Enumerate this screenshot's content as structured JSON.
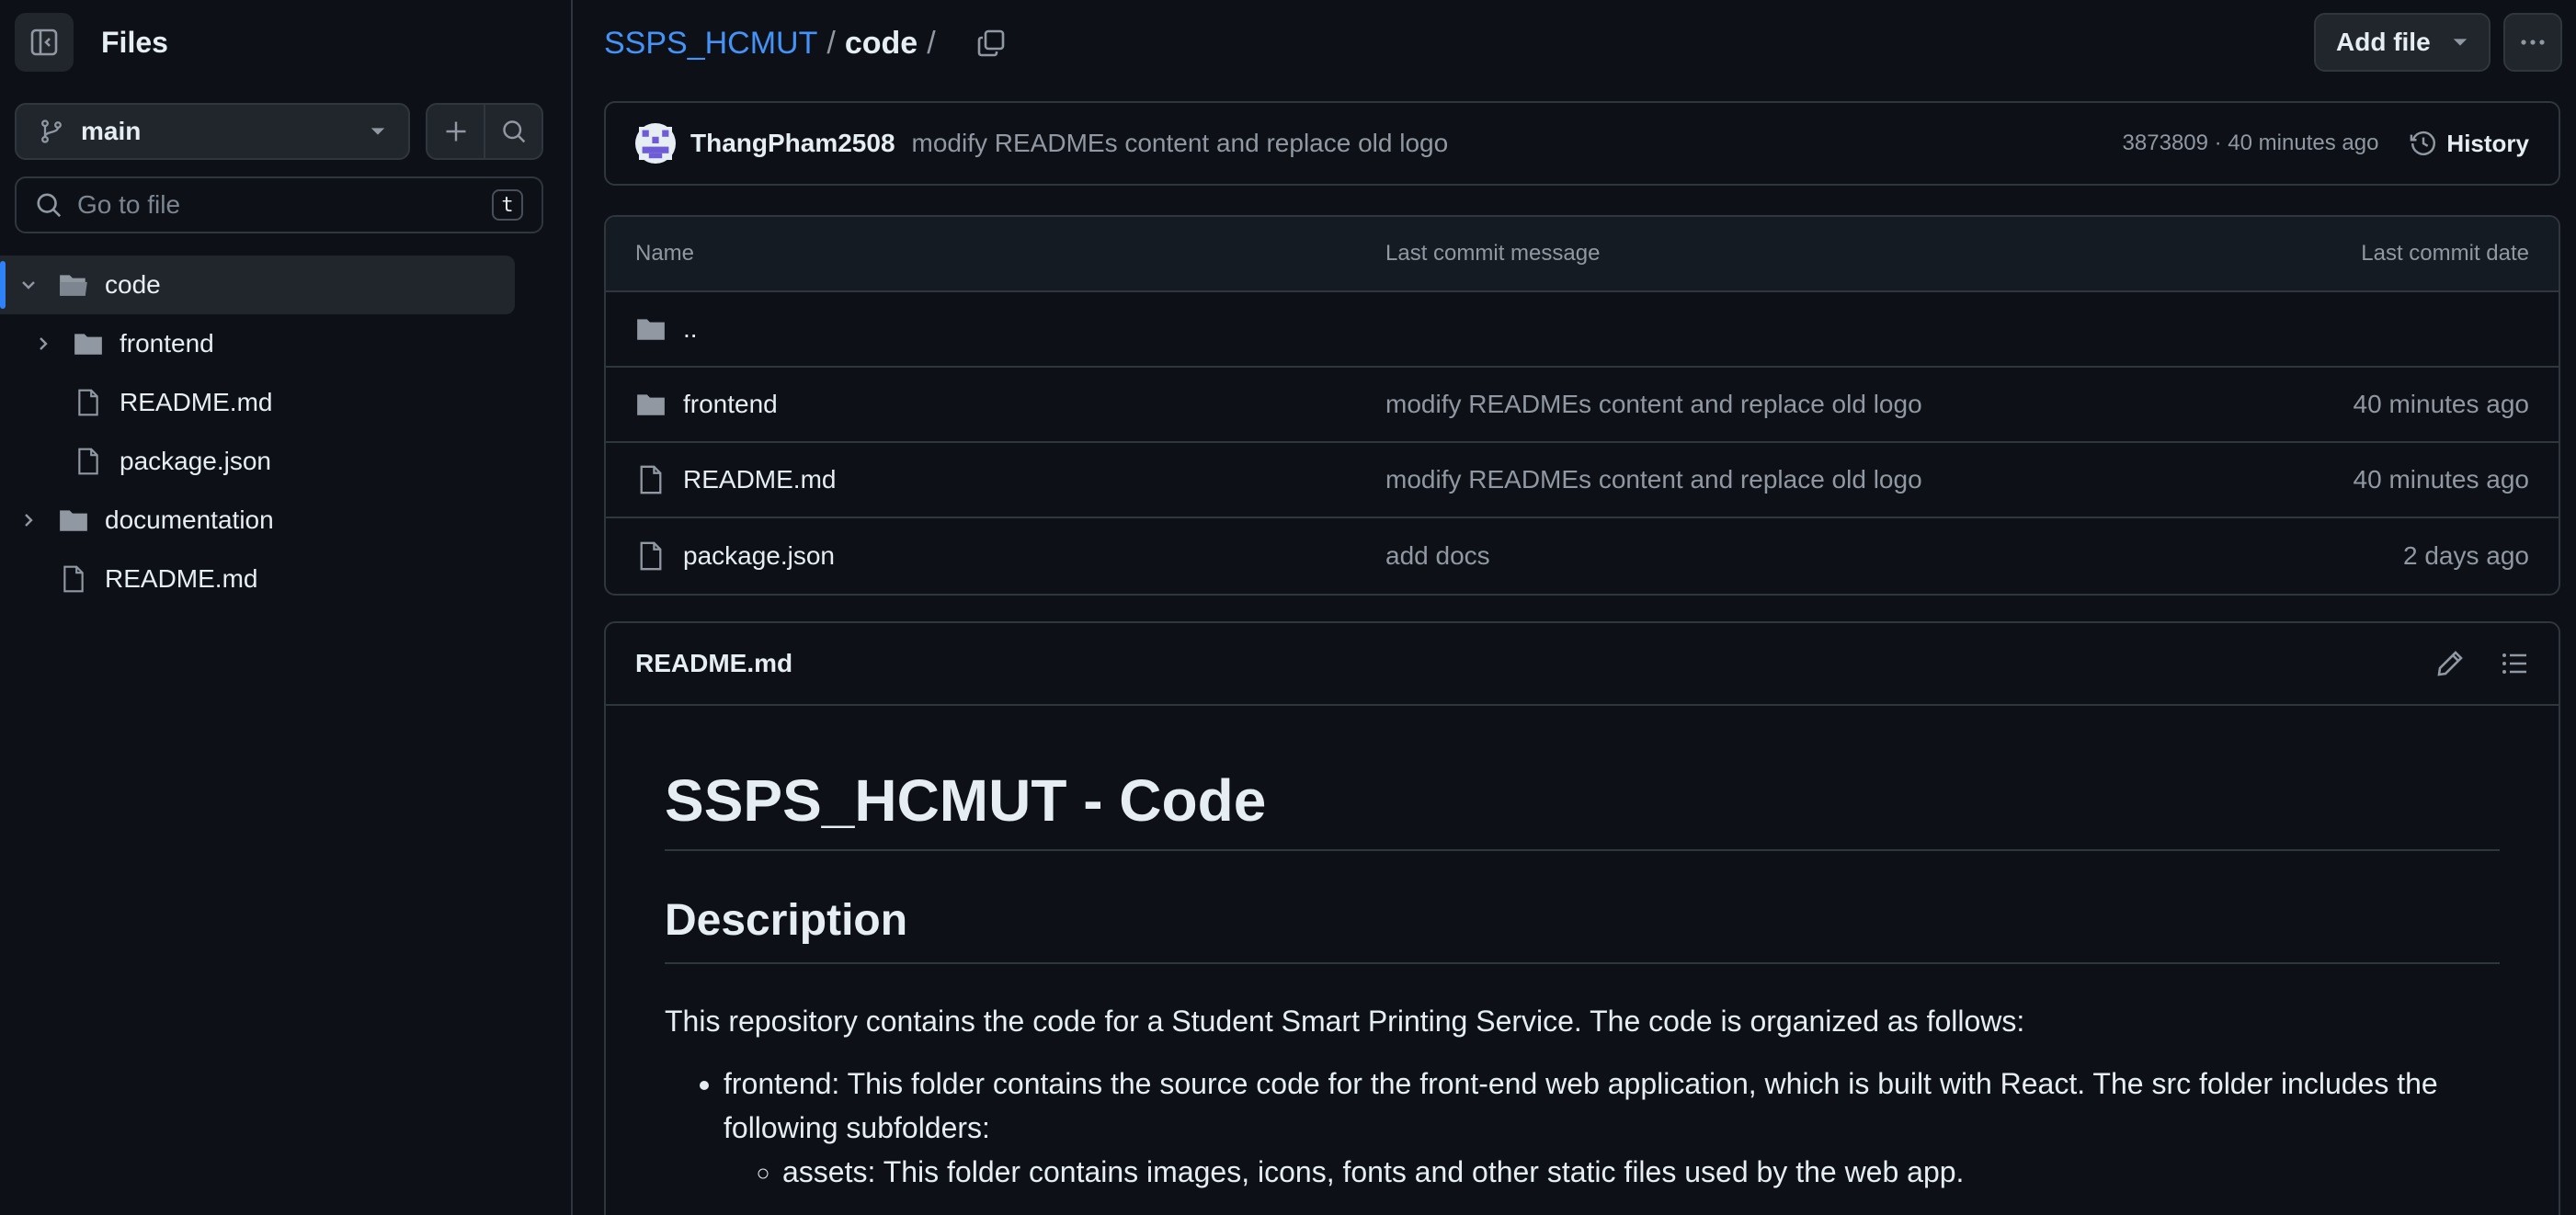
{
  "sidebar": {
    "title": "Files",
    "branch": "main",
    "goto_placeholder": "Go to file",
    "goto_shortcut": "t",
    "tree": [
      {
        "label": "code",
        "type": "folder-open",
        "expanded": true,
        "depth": 0
      },
      {
        "label": "frontend",
        "type": "folder",
        "expanded": false,
        "depth": 1
      },
      {
        "label": "README.md",
        "type": "file",
        "depth": 1
      },
      {
        "label": "package.json",
        "type": "file",
        "depth": 1
      },
      {
        "label": "documentation",
        "type": "folder",
        "expanded": false,
        "depth": 0
      },
      {
        "label": "README.md",
        "type": "file",
        "depth": 0
      }
    ]
  },
  "breadcrumb": {
    "repo": "SSPS_HCMUT",
    "separator": "/",
    "current": "code",
    "trailing": "/"
  },
  "toolbar": {
    "add_file": "Add file"
  },
  "commit": {
    "author": "ThangPham2508",
    "message": "modify READMEs content and replace old logo",
    "meta": "3873809 · 40 minutes ago",
    "history": "History"
  },
  "files": {
    "headers": {
      "name": "Name",
      "message": "Last commit message",
      "date": "Last commit date"
    },
    "parent": "..",
    "rows": [
      {
        "name": "frontend",
        "type": "folder",
        "message": "modify READMEs content and replace old logo",
        "date": "40 minutes ago"
      },
      {
        "name": "README.md",
        "type": "file",
        "message": "modify READMEs content and replace old logo",
        "date": "40 minutes ago"
      },
      {
        "name": "package.json",
        "type": "file",
        "message": "add docs",
        "date": "2 days ago"
      }
    ]
  },
  "readme": {
    "filename": "README.md",
    "h1": "SSPS_HCMUT - Code",
    "h2": "Description",
    "intro": "This repository contains the code for a Student Smart Printing Service. The code is organized as follows:",
    "bullet1": "frontend: This folder contains the source code for the front-end web application, which is built with React. The src folder includes the following subfolders:",
    "sub1": "assets: This folder contains images, icons, fonts and other static files used by the web app."
  },
  "colors": {
    "accent": "#4493f8",
    "bg": "#0d1117",
    "border": "#30363d",
    "muted": "#9198a1"
  }
}
